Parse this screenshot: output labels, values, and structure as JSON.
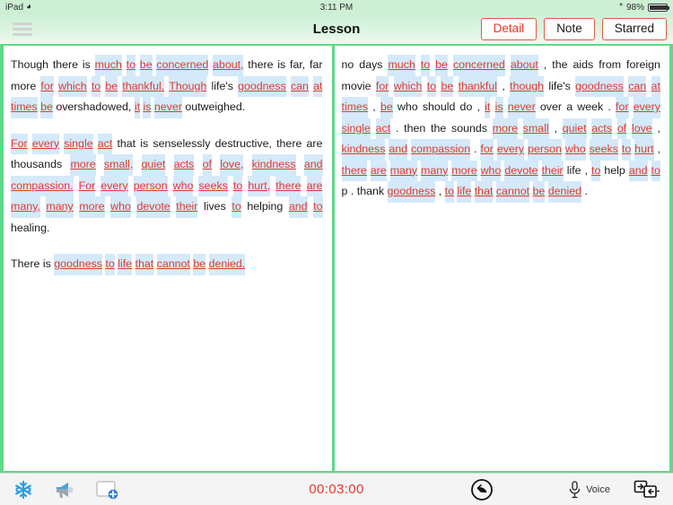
{
  "status_bar": {
    "device": "iPad",
    "wifi_icon": "wifi-icon",
    "time": "3:11 PM",
    "bluetooth_icon": "bluetooth-icon",
    "battery_percent": "98%",
    "battery_icon": "battery-icon"
  },
  "nav": {
    "menu_icon": "hamburger-menu-icon",
    "title": "Lesson",
    "buttons": [
      {
        "label": "Detail",
        "active": true
      },
      {
        "label": "Note",
        "active": false
      },
      {
        "label": "Starred",
        "active": false
      }
    ]
  },
  "left_pane": {
    "paragraphs": [
      [
        {
          "t": "Though",
          "s": "plain"
        },
        {
          "t": "there",
          "s": "plain"
        },
        {
          "t": "is",
          "s": "plain"
        },
        {
          "t": "much",
          "s": "red"
        },
        {
          "t": "to",
          "s": "red"
        },
        {
          "t": "be",
          "s": "red"
        },
        {
          "t": "concerned",
          "s": "red"
        },
        {
          "t": "about,",
          "s": "red"
        },
        {
          "t": "there",
          "s": "plain"
        },
        {
          "t": "is",
          "s": "plain"
        },
        {
          "t": "far,",
          "s": "plain"
        },
        {
          "t": "far",
          "s": "plain"
        },
        {
          "t": "more",
          "s": "plain"
        },
        {
          "t": "for",
          "s": "red"
        },
        {
          "t": "which",
          "s": "red"
        },
        {
          "t": "to",
          "s": "red"
        },
        {
          "t": "be",
          "s": "red"
        },
        {
          "t": "thankful.",
          "s": "red"
        },
        {
          "t": "Though",
          "s": "red"
        },
        {
          "t": "life's",
          "s": "plain"
        },
        {
          "t": "goodness",
          "s": "red"
        },
        {
          "t": "can",
          "s": "red"
        },
        {
          "t": "at",
          "s": "red"
        },
        {
          "t": "times",
          "s": "red"
        },
        {
          "t": "be",
          "s": "red"
        },
        {
          "t": "overshadowed,",
          "s": "plain"
        },
        {
          "t": "it",
          "s": "red"
        },
        {
          "t": "is",
          "s": "red"
        },
        {
          "t": "never",
          "s": "red"
        },
        {
          "t": "outweighed.",
          "s": "plain"
        }
      ],
      [
        {
          "t": "For",
          "s": "red"
        },
        {
          "t": "every",
          "s": "red"
        },
        {
          "t": "single",
          "s": "red"
        },
        {
          "t": "act",
          "s": "red"
        },
        {
          "t": "that",
          "s": "plain"
        },
        {
          "t": "is",
          "s": "plain"
        },
        {
          "t": "senselessly",
          "s": "plain"
        },
        {
          "t": "destructive,",
          "s": "plain"
        },
        {
          "t": "there",
          "s": "plain"
        },
        {
          "t": "are",
          "s": "plain"
        },
        {
          "t": "thousands",
          "s": "plain"
        },
        {
          "t": "more",
          "s": "red"
        },
        {
          "t": "small,",
          "s": "red"
        },
        {
          "t": "quiet",
          "s": "red"
        },
        {
          "t": "acts",
          "s": "red"
        },
        {
          "t": "of",
          "s": "red"
        },
        {
          "t": "love,",
          "s": "red"
        },
        {
          "t": "kindness",
          "s": "red"
        },
        {
          "t": "and",
          "s": "red"
        },
        {
          "t": "compassion.",
          "s": "red"
        },
        {
          "t": "For",
          "s": "red"
        },
        {
          "t": "every",
          "s": "red"
        },
        {
          "t": "person",
          "s": "red"
        },
        {
          "t": "who",
          "s": "red"
        },
        {
          "t": "seeks",
          "s": "red"
        },
        {
          "t": "to",
          "s": "red"
        },
        {
          "t": "hurt,",
          "s": "red"
        },
        {
          "t": "there",
          "s": "red"
        },
        {
          "t": "are",
          "s": "red"
        },
        {
          "t": "many,",
          "s": "red"
        },
        {
          "t": "many",
          "s": "red"
        },
        {
          "t": "more",
          "s": "red"
        },
        {
          "t": "who",
          "s": "red"
        },
        {
          "t": "devote",
          "s": "red"
        },
        {
          "t": "their",
          "s": "red"
        },
        {
          "t": "lives",
          "s": "plain"
        },
        {
          "t": "to",
          "s": "red"
        },
        {
          "t": "helping",
          "s": "plain"
        },
        {
          "t": "and",
          "s": "red"
        },
        {
          "t": "to",
          "s": "red"
        },
        {
          "t": "healing.",
          "s": "plain"
        }
      ],
      [
        {
          "t": "There",
          "s": "plain"
        },
        {
          "t": "is",
          "s": "plain"
        },
        {
          "t": "goodness",
          "s": "red"
        },
        {
          "t": "to",
          "s": "red"
        },
        {
          "t": "life",
          "s": "red"
        },
        {
          "t": "that",
          "s": "red"
        },
        {
          "t": "cannot",
          "s": "red"
        },
        {
          "t": "be",
          "s": "red"
        },
        {
          "t": "denied.",
          "s": "red"
        }
      ]
    ]
  },
  "right_pane": {
    "paragraphs": [
      [
        {
          "t": "no",
          "s": "plain"
        },
        {
          "t": "days",
          "s": "plain"
        },
        {
          "t": "much",
          "s": "red"
        },
        {
          "t": "to",
          "s": "red"
        },
        {
          "t": "be",
          "s": "red"
        },
        {
          "t": "concerned",
          "s": "red"
        },
        {
          "t": "about",
          "s": "red"
        },
        {
          "t": ",",
          "s": "plain"
        },
        {
          "t": "the",
          "s": "plain"
        },
        {
          "t": "aids",
          "s": "plain"
        },
        {
          "t": "from",
          "s": "plain"
        },
        {
          "t": "foreign",
          "s": "plain"
        },
        {
          "t": "movie",
          "s": "plain"
        },
        {
          "t": "for",
          "s": "red"
        },
        {
          "t": "which",
          "s": "red"
        },
        {
          "t": "to",
          "s": "red"
        },
        {
          "t": "be",
          "s": "red"
        },
        {
          "t": "thankful",
          "s": "red"
        },
        {
          "t": ",",
          "s": "plain"
        },
        {
          "t": "though",
          "s": "red"
        },
        {
          "t": "life's",
          "s": "plain"
        },
        {
          "t": "goodness",
          "s": "red"
        },
        {
          "t": "can",
          "s": "red"
        },
        {
          "t": "at",
          "s": "red"
        },
        {
          "t": "times",
          "s": "red"
        },
        {
          "t": ",",
          "s": "plain"
        },
        {
          "t": "be",
          "s": "red"
        },
        {
          "t": "who",
          "s": "plain"
        },
        {
          "t": "should",
          "s": "plain"
        },
        {
          "t": "do",
          "s": "plain"
        },
        {
          "t": ",",
          "s": "plain"
        },
        {
          "t": "it",
          "s": "red"
        },
        {
          "t": "is",
          "s": "red"
        },
        {
          "t": "never",
          "s": "red"
        },
        {
          "t": "over",
          "s": "plain"
        },
        {
          "t": "a",
          "s": "plain"
        },
        {
          "t": "week",
          "s": "plain"
        },
        {
          "t": ".",
          "s": "plain"
        },
        {
          "t": "for",
          "s": "red"
        },
        {
          "t": "every",
          "s": "red"
        },
        {
          "t": "single",
          "s": "red"
        },
        {
          "t": "act",
          "s": "red"
        },
        {
          "t": ".",
          "s": "plain"
        },
        {
          "t": "then",
          "s": "plain"
        },
        {
          "t": "the",
          "s": "plain"
        },
        {
          "t": "sounds",
          "s": "plain"
        },
        {
          "t": "more",
          "s": "red"
        },
        {
          "t": "small",
          "s": "red"
        },
        {
          "t": ",",
          "s": "plain"
        },
        {
          "t": "quiet",
          "s": "red"
        },
        {
          "t": "acts",
          "s": "red"
        },
        {
          "t": "of",
          "s": "red"
        },
        {
          "t": "love",
          "s": "red"
        },
        {
          "t": ",",
          "s": "plain"
        },
        {
          "t": "kindness",
          "s": "red"
        },
        {
          "t": "and",
          "s": "red"
        },
        {
          "t": "compassion",
          "s": "red"
        },
        {
          "t": ".",
          "s": "plain"
        },
        {
          "t": "for",
          "s": "red"
        },
        {
          "t": "every",
          "s": "red"
        },
        {
          "t": "person",
          "s": "red"
        },
        {
          "t": "who",
          "s": "red"
        },
        {
          "t": "seeks",
          "s": "red"
        },
        {
          "t": "to",
          "s": "red"
        },
        {
          "t": "hurt",
          "s": "red"
        },
        {
          "t": ",",
          "s": "plain"
        },
        {
          "t": "there",
          "s": "red"
        },
        {
          "t": "are",
          "s": "red"
        },
        {
          "t": "many",
          "s": "red"
        },
        {
          "t": "many",
          "s": "red"
        },
        {
          "t": "more",
          "s": "red"
        },
        {
          "t": "who",
          "s": "red"
        },
        {
          "t": "devote",
          "s": "red"
        },
        {
          "t": "their",
          "s": "red"
        },
        {
          "t": "life",
          "s": "plain"
        },
        {
          "t": ",",
          "s": "plain"
        },
        {
          "t": "to",
          "s": "red"
        },
        {
          "t": "help",
          "s": "plain"
        },
        {
          "t": "and",
          "s": "red"
        },
        {
          "t": "to",
          "s": "red"
        },
        {
          "t": "p",
          "s": "plain"
        },
        {
          "t": ".",
          "s": "plain"
        },
        {
          "t": "thank",
          "s": "plain"
        },
        {
          "t": "goodness",
          "s": "red"
        },
        {
          "t": ",",
          "s": "plain"
        },
        {
          "t": "to",
          "s": "red"
        },
        {
          "t": "life",
          "s": "red"
        },
        {
          "t": "that",
          "s": "red"
        },
        {
          "t": "cannot",
          "s": "red"
        },
        {
          "t": "be",
          "s": "red"
        },
        {
          "t": "denied",
          "s": "red"
        },
        {
          "t": ".",
          "s": "plain"
        }
      ]
    ]
  },
  "toolbar": {
    "snowflake_icon": "snowflake-icon",
    "megaphone_icon": "megaphone-icon",
    "add_card_icon": "add-card-icon",
    "timer": "00:03:00",
    "back_icon": "back-arrow-icon",
    "voice_icon": "microphone-icon",
    "voice_label": "Voice",
    "swap_icon": "card-swap-icon"
  },
  "colors": {
    "accent_red": "#e8392a",
    "highlight_blue": "#d4e9fa",
    "frame_green": "#5fd98a",
    "statusbar_green": "#cdf0d5"
  }
}
